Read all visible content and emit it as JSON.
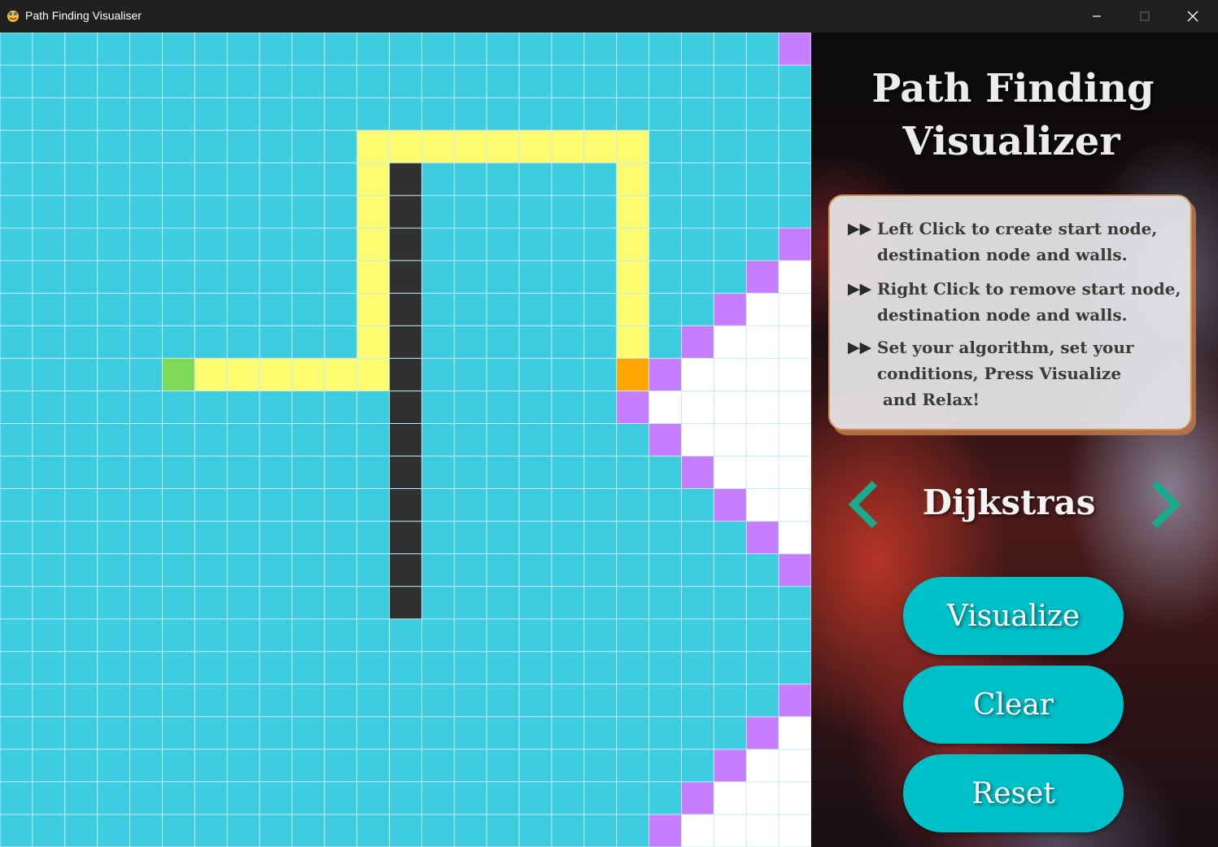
{
  "window": {
    "title": "Path Finding Visualiser",
    "icon": "pygame-snake-icon"
  },
  "grid": {
    "cols": 25,
    "rows": 25,
    "colors": {
      "empty": "#3ecde0",
      "line": "#c6ecf5",
      "wall": "#303030",
      "path": "#fdfc71",
      "visited": "#ffffff",
      "frontier": "#c77dff",
      "start": "#7ed957",
      "end": "#ffa500"
    },
    "start": [
      5,
      10
    ],
    "end": [
      19,
      10
    ],
    "walls": [
      [
        12,
        4
      ],
      [
        12,
        5
      ],
      [
        12,
        6
      ],
      [
        12,
        7
      ],
      [
        12,
        8
      ],
      [
        12,
        9
      ],
      [
        12,
        10
      ],
      [
        12,
        11
      ],
      [
        12,
        12
      ],
      [
        12,
        13
      ],
      [
        12,
        14
      ],
      [
        12,
        15
      ],
      [
        12,
        16
      ],
      [
        12,
        17
      ]
    ],
    "path": [
      [
        6,
        10
      ],
      [
        7,
        10
      ],
      [
        8,
        10
      ],
      [
        9,
        10
      ],
      [
        10,
        10
      ],
      [
        11,
        10
      ],
      [
        11,
        9
      ],
      [
        11,
        8
      ],
      [
        11,
        7
      ],
      [
        11,
        6
      ],
      [
        11,
        5
      ],
      [
        11,
        4
      ],
      [
        11,
        3
      ],
      [
        12,
        3
      ],
      [
        13,
        3
      ],
      [
        14,
        3
      ],
      [
        15,
        3
      ],
      [
        16,
        3
      ],
      [
        17,
        3
      ],
      [
        18,
        3
      ],
      [
        19,
        3
      ],
      [
        19,
        4
      ],
      [
        19,
        5
      ],
      [
        19,
        6
      ],
      [
        19,
        7
      ],
      [
        19,
        8
      ],
      [
        19,
        9
      ]
    ],
    "frontier": [
      [
        24,
        0
      ],
      [
        24,
        6
      ],
      [
        23,
        7
      ],
      [
        22,
        8
      ],
      [
        21,
        9
      ],
      [
        20,
        10
      ],
      [
        19,
        11
      ],
      [
        20,
        12
      ],
      [
        21,
        13
      ],
      [
        22,
        14
      ],
      [
        23,
        15
      ],
      [
        24,
        16
      ],
      [
        24,
        20
      ],
      [
        23,
        21
      ],
      [
        22,
        22
      ],
      [
        21,
        23
      ],
      [
        20,
        24
      ]
    ],
    "visited": [
      [
        24,
        7
      ],
      [
        23,
        8
      ],
      [
        24,
        8
      ],
      [
        22,
        9
      ],
      [
        23,
        9
      ],
      [
        24,
        9
      ],
      [
        21,
        10
      ],
      [
        22,
        10
      ],
      [
        23,
        10
      ],
      [
        24,
        10
      ],
      [
        20,
        11
      ],
      [
        21,
        11
      ],
      [
        22,
        11
      ],
      [
        23,
        11
      ],
      [
        24,
        11
      ],
      [
        21,
        12
      ],
      [
        22,
        12
      ],
      [
        23,
        12
      ],
      [
        24,
        12
      ],
      [
        22,
        13
      ],
      [
        23,
        13
      ],
      [
        24,
        13
      ],
      [
        23,
        14
      ],
      [
        24,
        14
      ],
      [
        24,
        15
      ],
      [
        24,
        21
      ],
      [
        23,
        22
      ],
      [
        24,
        22
      ],
      [
        22,
        23
      ],
      [
        23,
        23
      ],
      [
        24,
        23
      ],
      [
        21,
        24
      ],
      [
        22,
        24
      ],
      [
        23,
        24
      ],
      [
        24,
        24
      ]
    ]
  },
  "panel": {
    "title_line1": "Path Finding",
    "title_line2": "Visualizer",
    "instructions": [
      "Left Click to create start node,\ndestination node and walls.",
      "Right Click to remove start node,\ndestination node and walls.",
      "Set your algorithm, set your\nconditions, Press Visualize\n and Relax!"
    ],
    "bullet_icon": "fast-forward-icon",
    "algorithm": "Dijkstras",
    "arrow_color": "#1aaa8e",
    "buttons": {
      "visualize": "Visualize",
      "clear": "Clear",
      "reset": "Reset"
    },
    "button_color": "#00c0c8"
  }
}
